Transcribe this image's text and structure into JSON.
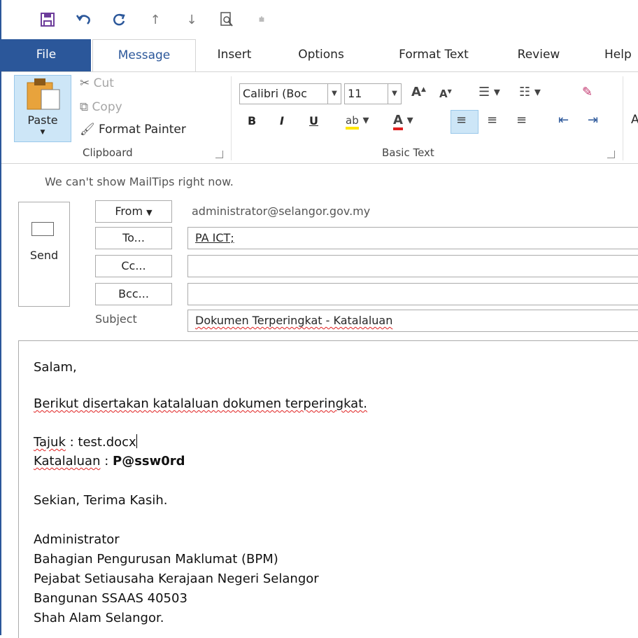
{
  "tabs": [
    "File",
    "Message",
    "Insert",
    "Options",
    "Format Text",
    "Review",
    "Help"
  ],
  "clipboard": {
    "paste_label": "Paste",
    "cut_label": "Cut",
    "copy_label": "Copy",
    "format_painter_label": "Format Painter",
    "group_label": "Clipboard"
  },
  "basic_text": {
    "font_name": "Calibri (Boc",
    "font_size": "11",
    "bold": "B",
    "italic": "I",
    "underline": "U",
    "group_label": "Basic Text",
    "extra_glyph": "A"
  },
  "compose": {
    "mailtips": "We can't show MailTips right now.",
    "send_label": "Send",
    "from_label": "From",
    "from_address": "administrator@selangor.gov.my",
    "to_label": "To...",
    "to_value": "PA ICT;",
    "cc_label": "Cc...",
    "bcc_label": "Bcc...",
    "subject_label": "Subject",
    "subject_value": "Dokumen Terperingkat - Katalaluan"
  },
  "body": {
    "greeting": "Salam,",
    "line1": "Berikut disertakan katalaluan dokumen terperingkat.",
    "tajuk_label": "Tajuk",
    "tajuk_value": " : test.docx",
    "katalaluan_label": "Katalaluan",
    "katalaluan_sep": " : ",
    "katalaluan_value": "P@ssw0rd",
    "closing": "Sekian, Terima Kasih.",
    "sig1": "Administrator",
    "sig2": "Bahagian Pengurusan Maklumat (BPM)",
    "sig3": "Pejabat Setiausaha Kerajaan Negeri Selangor",
    "sig4": "Bangunan SSAAS 40503",
    "sig5": "Shah Alam Selangor."
  },
  "colors": {
    "accent": "#2b579a",
    "spell_error": "#e02020"
  }
}
